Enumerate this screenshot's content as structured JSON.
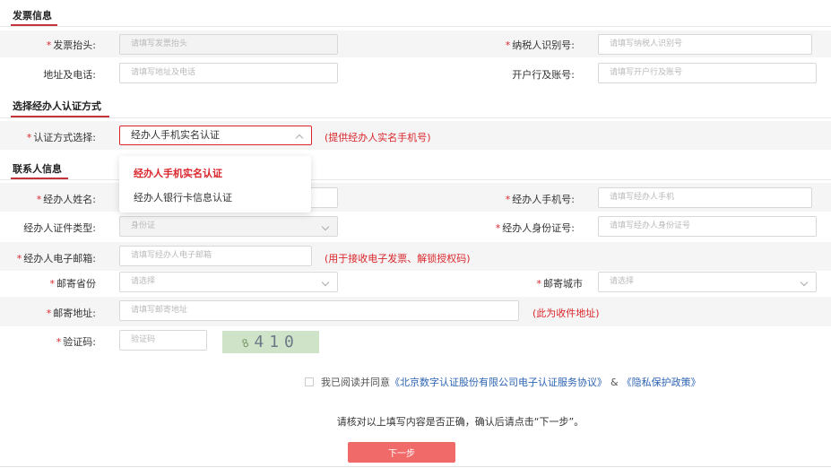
{
  "sections": {
    "invoice": "发票信息",
    "auth_method": "选择经办人认证方式",
    "contact": "联系人信息"
  },
  "invoice": {
    "title_label": "发票抬头:",
    "title_placeholder": "请填写发票抬头",
    "taxid_label": "纳税人识别号:",
    "taxid_placeholder": "请填写纳税人识别号",
    "address_label": "地址及电话:",
    "address_placeholder": "请填写地址及电话",
    "bank_label": "开户行及账号:",
    "bank_placeholder": "请填写开户行及账号"
  },
  "auth": {
    "label": "认证方式选择:",
    "selected": "经办人手机实名认证",
    "hint": "(提供经办人实名手机号)",
    "options": [
      "经办人手机实名认证",
      "经办人银行卡信息认证"
    ]
  },
  "contact": {
    "name_label": "经办人姓名:",
    "phone_label": "经办人手机号:",
    "phone_placeholder": "请填写经办人手机",
    "idtype_label": "经办人证件类型:",
    "idtype_value": "身份证",
    "idnum_label": "经办人身份证号:",
    "idnum_placeholder": "请填写经办人身份证号",
    "email_label": "经办人电子邮箱:",
    "email_placeholder": "请填写经办人电子邮箱",
    "email_hint": "(用于接收电子发票、解锁授权码)",
    "province_label": "邮寄省份",
    "province_placeholder": "请选择",
    "city_label": "邮寄城市",
    "city_placeholder": "请选择",
    "mail_address_label": "邮寄地址:",
    "mail_address_placeholder": "请填写邮寄地址",
    "mail_address_hint": "(此为收件地址)",
    "captcha_label": "验证码:",
    "captcha_placeholder": "验证码",
    "captcha_small": "8",
    "captcha_text": "410"
  },
  "agreement": {
    "prefix": "我已阅读并同意",
    "link1": "《北京数字认证股份有限公司电子认证服务协议》",
    "amp": "&",
    "link2": "《隐私保护政策》"
  },
  "confirm_text": "请核对以上填写内容是否正确，确认后请点击“下一步”。",
  "next_button": "下一步",
  "required_mark": "*"
}
